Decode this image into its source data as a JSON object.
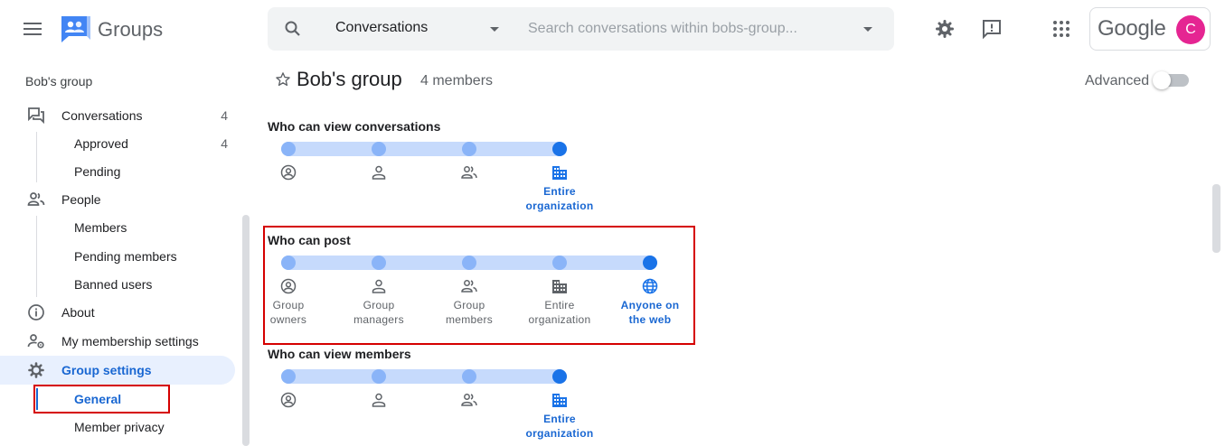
{
  "header": {
    "app_name": "Groups",
    "search_scope": "Conversations",
    "search_placeholder": "Search conversations within bobs-group...",
    "account_brand": "Google",
    "avatar_letter": "C"
  },
  "sidebar": {
    "group_title": "Bob's group",
    "conversations": {
      "label": "Conversations",
      "count": "4"
    },
    "approved": {
      "label": "Approved",
      "count": "4"
    },
    "pending": {
      "label": "Pending"
    },
    "people": {
      "label": "People"
    },
    "members": {
      "label": "Members"
    },
    "pending_members": {
      "label": "Pending members"
    },
    "banned_users": {
      "label": "Banned users"
    },
    "about": {
      "label": "About"
    },
    "membership": {
      "label": "My membership settings"
    },
    "group_settings": {
      "label": "Group settings"
    },
    "general": {
      "label": "General"
    },
    "member_privacy": {
      "label": "Member privacy"
    }
  },
  "main": {
    "title": "Bob's group",
    "members_count": "4 members",
    "advanced_label": "Advanced",
    "advanced_enabled": false
  },
  "settings": {
    "view_conversations": {
      "title": "Who can view conversations",
      "selected_label_line1": "Entire",
      "selected_label_line2": "organization"
    },
    "post": {
      "title": "Who can post",
      "options": [
        {
          "line1": "Group",
          "line2": "owners"
        },
        {
          "line1": "Group",
          "line2": "managers"
        },
        {
          "line1": "Group",
          "line2": "members"
        },
        {
          "line1": "Entire",
          "line2": "organization"
        },
        {
          "line1": "Anyone on",
          "line2": "the web"
        }
      ]
    },
    "view_members": {
      "title": "Who can view members",
      "selected_label_line1": "Entire",
      "selected_label_line2": "organization"
    }
  },
  "colors": {
    "accent": "#1a73e8",
    "accent_text": "#1967d2",
    "track": "#c6dafc",
    "dot": "#8ab4f8",
    "highlight_border": "#d50000",
    "avatar": "#e52592"
  }
}
